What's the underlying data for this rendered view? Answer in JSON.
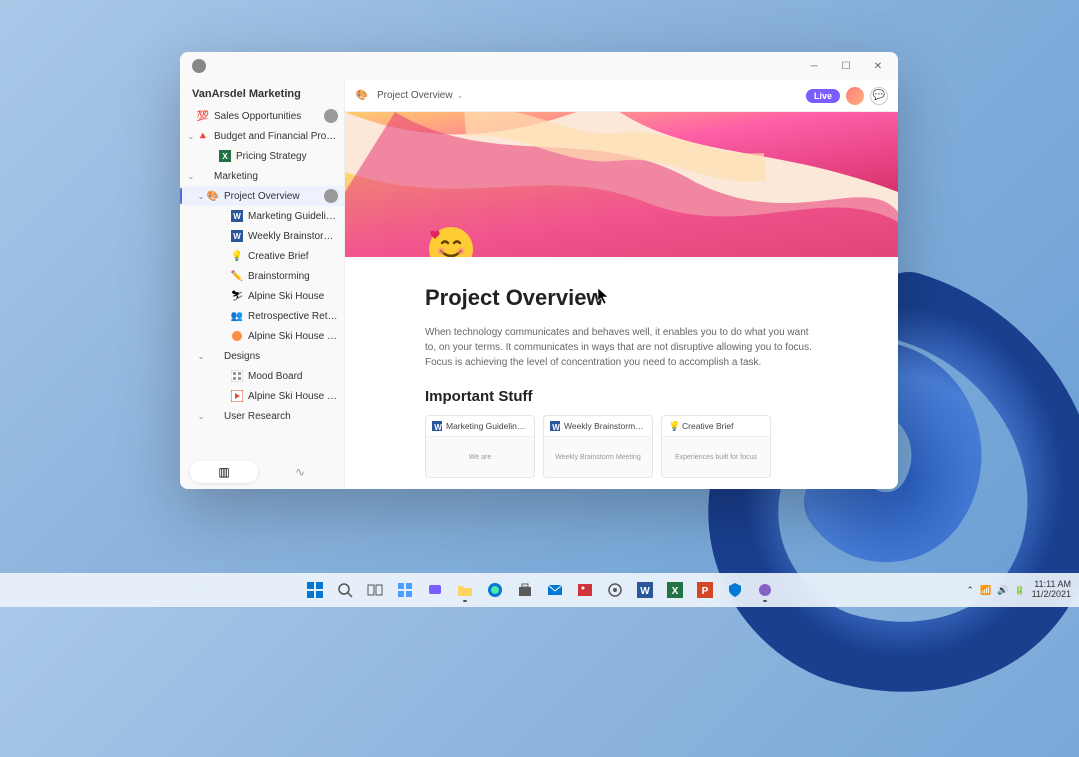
{
  "workspace": {
    "title": "VanArsdel Marketing"
  },
  "tree": [
    {
      "lvl": 1,
      "chev": "",
      "icon": "💯",
      "label": "Sales Opportunities",
      "avatar": true
    },
    {
      "lvl": 1,
      "chev": "⌄",
      "icon": "🔺",
      "label": "Budget and Financial Projection"
    },
    {
      "lvl": 3,
      "chev": "",
      "icon": "x",
      "label": "Pricing Strategy"
    },
    {
      "lvl": 1,
      "chev": "⌄",
      "icon": "",
      "label": "Marketing"
    },
    {
      "lvl": 2,
      "chev": "⌄",
      "icon": "🎨",
      "label": "Project Overview",
      "avatar": true,
      "selected": true
    },
    {
      "lvl": 4,
      "chev": "",
      "icon": "w",
      "label": "Marketing Guidelines for V…"
    },
    {
      "lvl": 4,
      "chev": "",
      "icon": "w",
      "label": "Weekly Brainstorm Meeting"
    },
    {
      "lvl": 4,
      "chev": "",
      "icon": "💡",
      "label": "Creative Brief"
    },
    {
      "lvl": 4,
      "chev": "",
      "icon": "✏️",
      "label": "Brainstorming"
    },
    {
      "lvl": 4,
      "chev": "",
      "icon": "⛷",
      "label": "Alpine Ski House"
    },
    {
      "lvl": 4,
      "chev": "",
      "icon": "👥",
      "label": "Retrospective Retreat"
    },
    {
      "lvl": 4,
      "chev": "",
      "icon": "●",
      "label": "Alpine Ski House (ID: 487…"
    },
    {
      "lvl": 2,
      "chev": "⌄",
      "icon": "",
      "label": "Designs"
    },
    {
      "lvl": 4,
      "chev": "",
      "icon": "▦",
      "label": "Mood Board"
    },
    {
      "lvl": 4,
      "chev": "",
      "icon": "▶",
      "label": "Alpine Ski House Sizzle Re…"
    },
    {
      "lvl": 2,
      "chev": "⌄",
      "icon": "",
      "label": "User Research"
    }
  ],
  "topbar": {
    "breadcrumb": "Project Overview",
    "live": "Live"
  },
  "page": {
    "title": "Project Overview",
    "desc": "When technology communicates and behaves well, it enables you to do what you want to, on your terms. It communicates in ways that are not disruptive allowing you to focus. Focus is achieving the level of concentration you need to accomplish a task.",
    "section": "Important Stuff"
  },
  "cards": [
    {
      "icon": "w",
      "title": "Marketing Guidelines f…",
      "preview": "We are"
    },
    {
      "icon": "w",
      "title": "Weekly Brainstorm Me…",
      "preview": "Weekly Brainstorm Meeting"
    },
    {
      "icon": "💡",
      "title": "Creative Brief",
      "preview": "Experiences built for focus"
    }
  ],
  "taskbar": {
    "time": "11:11 AM",
    "date": "11/2/2021"
  }
}
